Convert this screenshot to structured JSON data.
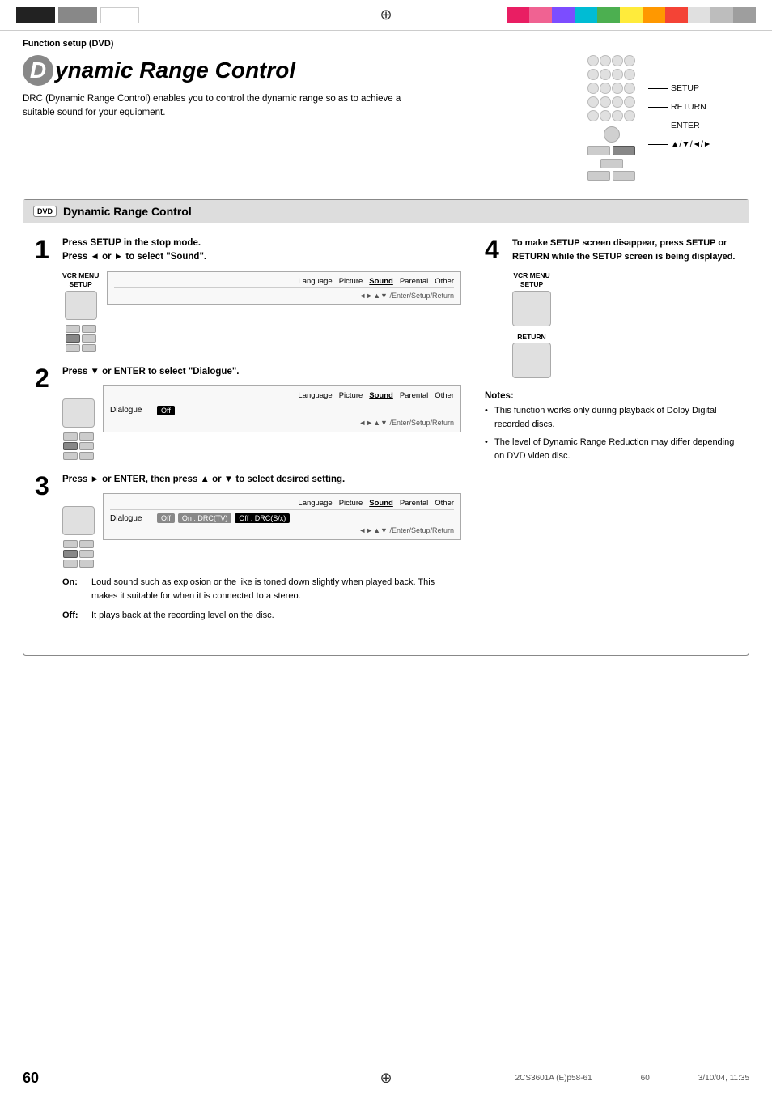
{
  "topBar": {
    "registrationMark": "⊕",
    "colorBlocks": [
      "#e91e63",
      "#f06292",
      "#7c4dff",
      "#00bcd4",
      "#4caf50",
      "#ffeb3b",
      "#ff9800",
      "#f44336",
      "#e0e0e0",
      "#bdbdbd",
      "#9e9e9e"
    ]
  },
  "header": {
    "functionLabel": "Function setup (DVD)"
  },
  "title": {
    "letter": "D",
    "text": "ynamic Range Control",
    "description": "DRC (Dynamic Range Control) enables you to control the dynamic range so as to achieve a suitable sound for your equipment."
  },
  "remoteLabels": {
    "setup": "SETUP",
    "return": "RETURN",
    "enter": "ENTER",
    "arrows": "▲/▼/◄/►"
  },
  "mainBox": {
    "dvdBadge": "DVD",
    "title": "Dynamic Range Control"
  },
  "steps": {
    "step1": {
      "number": "1",
      "line1": "Press SETUP in the stop mode.",
      "line2": "Press ◄ or ► to select \"Sound\".",
      "vcrLabel": "VCR MENU",
      "setupLabel": "SETUP",
      "menuTabs": [
        "Language",
        "Picture",
        "Sound",
        "Parental",
        "Other"
      ],
      "activeTab": "Sound",
      "navHint": "◄►▲▼ /Enter/Setup/Return"
    },
    "step2": {
      "number": "2",
      "instruction": "Press ▼ or ENTER to select \"Dialogue\".",
      "menuTabs": [
        "Language",
        "Picture",
        "Sound",
        "Parental",
        "Other"
      ],
      "activeTab": "Sound",
      "menuRow": "Dialogue",
      "menuOption": "Off",
      "navHint": "◄►▲▼ /Enter/Setup/Return"
    },
    "step3": {
      "number": "3",
      "instruction": "Press ► or ENTER, then press ▲ or ▼ to select desired setting.",
      "menuTabs": [
        "Language",
        "Picture",
        "Sound",
        "Parental",
        "Other"
      ],
      "activeTab": "Sound",
      "menuRow": "Dialogue",
      "menuOptions": [
        "Off",
        "On : DRC(TV)",
        "Off : DRC(S/x)"
      ],
      "selectedOption": "Off : DRC(S/x)",
      "navHint": "◄►▲▼ /Enter/Setup/Return"
    },
    "step4": {
      "number": "4",
      "instruction": "To make SETUP screen disappear, press SETUP or RETURN while the SETUP screen is being displayed.",
      "vcrMenuLabel": "VCR MENU",
      "setupLabel": "SETUP",
      "returnLabel": "RETURN"
    }
  },
  "descriptions": {
    "on": {
      "term": "On:",
      "text": "Loud sound such as explosion or the like is toned down slightly when played back. This makes it suitable for when it is connected to a stereo."
    },
    "off": {
      "term": "Off:",
      "text": "It plays back at the recording level on the disc."
    }
  },
  "notes": {
    "title": "Notes:",
    "items": [
      "This function works only during playback of Dolby Digital recorded discs.",
      "The level of Dynamic Range Reduction may differ depending on DVD video disc."
    ]
  },
  "footer": {
    "pageNumber": "60",
    "printCode": "2CS3601A (E)p58-61",
    "pageRef": "60",
    "date": "3/10/04, 11:35"
  }
}
